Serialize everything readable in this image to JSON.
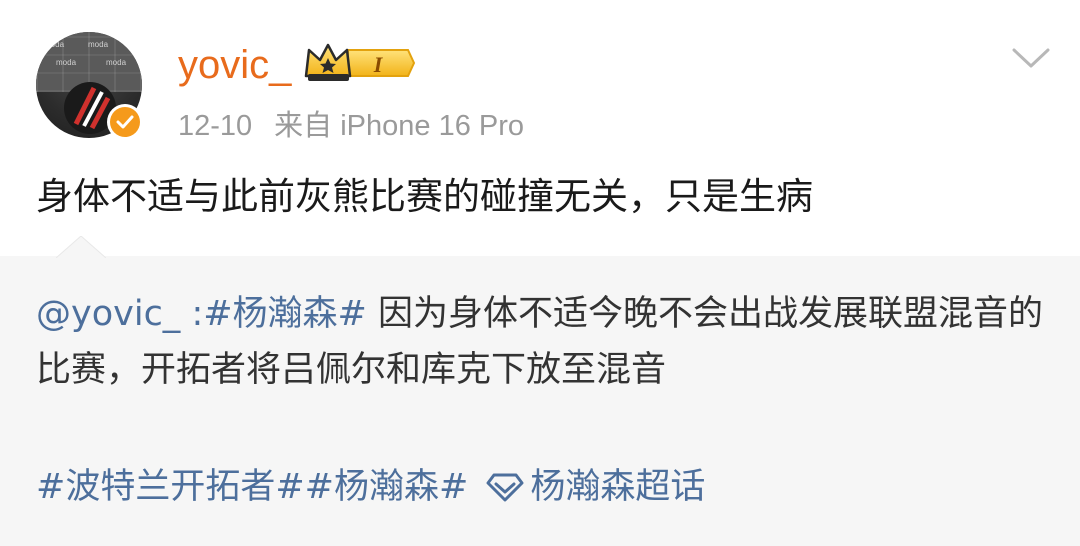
{
  "user": {
    "name": "yovic_",
    "level_badge": "I",
    "date": "12-10",
    "source": "来自 iPhone 16 Pro",
    "avatar_wall_text": "moda"
  },
  "post": {
    "text": "身体不适与此前灰熊比赛的碰撞无关，只是生病"
  },
  "repost": {
    "mention": "@yovic_",
    "separator": " :",
    "topic_tag": "#杨瀚森#",
    "body": " 因为身体不适今晚不会出战发展联盟混音的比赛，开拓者将吕佩尔和库克下放至混音",
    "topics": [
      "#波特兰开拓者#",
      "#杨瀚森#"
    ],
    "supertopic": "杨瀚森超话"
  },
  "icons": {
    "chevron": "chevron-down-icon",
    "verified": "verified-badge-icon",
    "crown": "crown-icon",
    "supertopic": "diamond-supertopic-icon"
  },
  "colors": {
    "username": "#e86b1c",
    "link": "#4d6f9c",
    "meta": "#9a9a9a",
    "repost_bg": "#f6f6f6",
    "verified": "#f59a1b"
  }
}
